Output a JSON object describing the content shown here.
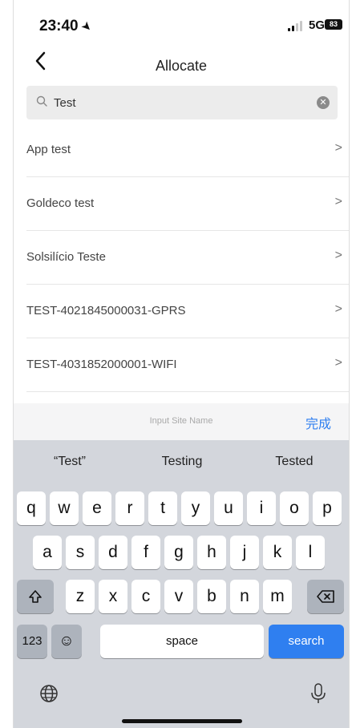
{
  "status": {
    "time": "23:40",
    "network": "5G",
    "battery": "83"
  },
  "nav": {
    "title": "Allocate"
  },
  "search": {
    "value": "Test",
    "placeholder": ""
  },
  "list": [
    {
      "label": "App test"
    },
    {
      "label": "Goldeco test"
    },
    {
      "label": "Solsilício Teste"
    },
    {
      "label": "TEST-4021845000031-GPRS"
    },
    {
      "label": "TEST-4031852000001-WIFI"
    }
  ],
  "accessory": {
    "placeholder": "Input Site Name",
    "done": "完成"
  },
  "suggestions": [
    "“Test”",
    "Testing",
    "Tested"
  ],
  "keyboard": {
    "row1": [
      "q",
      "w",
      "e",
      "r",
      "t",
      "y",
      "u",
      "i",
      "o",
      "p"
    ],
    "row2": [
      "a",
      "s",
      "d",
      "f",
      "g",
      "h",
      "j",
      "k",
      "l"
    ],
    "row3": [
      "z",
      "x",
      "c",
      "v",
      "b",
      "n",
      "m"
    ],
    "numbers": "123",
    "space": "space",
    "search": "search"
  },
  "colors": {
    "accent": "#2f7ff0",
    "keyboard_bg": "#d3d6dc"
  }
}
